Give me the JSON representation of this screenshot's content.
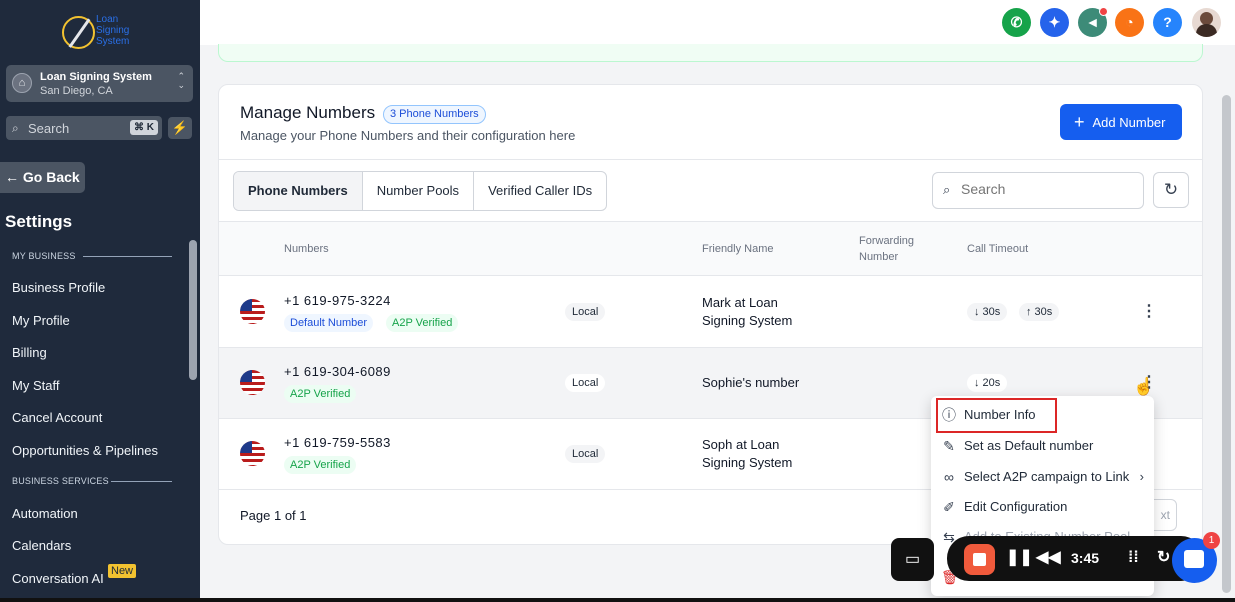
{
  "sidebar": {
    "logo_text": [
      "Loan",
      "Signing",
      "System"
    ],
    "account": {
      "name": "Loan Signing System",
      "location": "San Diego, CA"
    },
    "search": {
      "placeholder": "Search",
      "shortcut": "⌘ K"
    },
    "go_back": "Go Back",
    "settings_title": "Settings",
    "section_my_business": "MY BUSINESS",
    "section_business_services": "BUSINESS SERVICES",
    "items": [
      {
        "label": "Business Profile"
      },
      {
        "label": "My Profile"
      },
      {
        "label": "Billing"
      },
      {
        "label": "My Staff"
      },
      {
        "label": "Cancel Account"
      },
      {
        "label": "Opportunities & Pipelines"
      },
      {
        "label": "Automation"
      },
      {
        "label": "Calendars"
      },
      {
        "label": "Conversation AI"
      }
    ],
    "new_badge": "New"
  },
  "topbar": {
    "buttons": [
      {
        "icon": "phone-icon",
        "color": "#16a34a"
      },
      {
        "icon": "sparkle-icon",
        "color": "#2563eb"
      },
      {
        "icon": "megaphone-icon",
        "color": "#3d8b78"
      },
      {
        "icon": "bell-icon",
        "color": "#f97316"
      },
      {
        "icon": "help-icon",
        "color": "#2684fc",
        "glyph": "?"
      }
    ]
  },
  "card": {
    "title": "Manage Numbers",
    "count_badge": "3 Phone Numbers",
    "subtitle": "Manage your Phone Numbers and their configuration here",
    "add_button": "Add Number",
    "tabs": [
      {
        "label": "Phone Numbers",
        "active": true
      },
      {
        "label": "Number Pools",
        "active": false
      },
      {
        "label": "Verified Caller IDs",
        "active": false
      }
    ],
    "search_placeholder": "Search",
    "columns": {
      "numbers": "Numbers",
      "friendly_name": "Friendly Name",
      "forwarding_1": "Forwarding",
      "forwarding_2": "Number",
      "call_timeout": "Call Timeout"
    },
    "rows": [
      {
        "number": "+1 619-975-3224",
        "tags": [
          "Default Number",
          "A2P Verified"
        ],
        "type": "Local",
        "friendly": [
          "Mark at Loan",
          "Signing System"
        ],
        "timeout_in": "↓ 30s",
        "timeout_out": "↑ 30s"
      },
      {
        "number": "+1 619-304-6089",
        "tags": [
          "A2P Verified"
        ],
        "type": "Local",
        "friendly": [
          "Sophie's number"
        ],
        "timeout_in": "↓ 20s",
        "timeout_out": ""
      },
      {
        "number": "+1 619-759-5583",
        "tags": [
          "A2P Verified"
        ],
        "type": "Local",
        "friendly": [
          "Soph at Loan",
          "Signing System"
        ],
        "timeout_in": "",
        "timeout_out": ""
      }
    ],
    "pager": "Page 1 of 1",
    "next_button": "xt"
  },
  "menu": {
    "items": [
      {
        "icon": "info-icon",
        "label": "Number Info"
      },
      {
        "icon": "pin-icon",
        "label": "Set as Default number"
      },
      {
        "icon": "link-icon",
        "label": "Select A2P campaign to Link"
      },
      {
        "icon": "pencil-icon",
        "label": "Edit Configuration"
      },
      {
        "icon": "swap-icon",
        "label": "Add to Existing Number Pool"
      }
    ]
  },
  "recorder": {
    "time": "3:45"
  },
  "chat": {
    "unread": "1"
  }
}
